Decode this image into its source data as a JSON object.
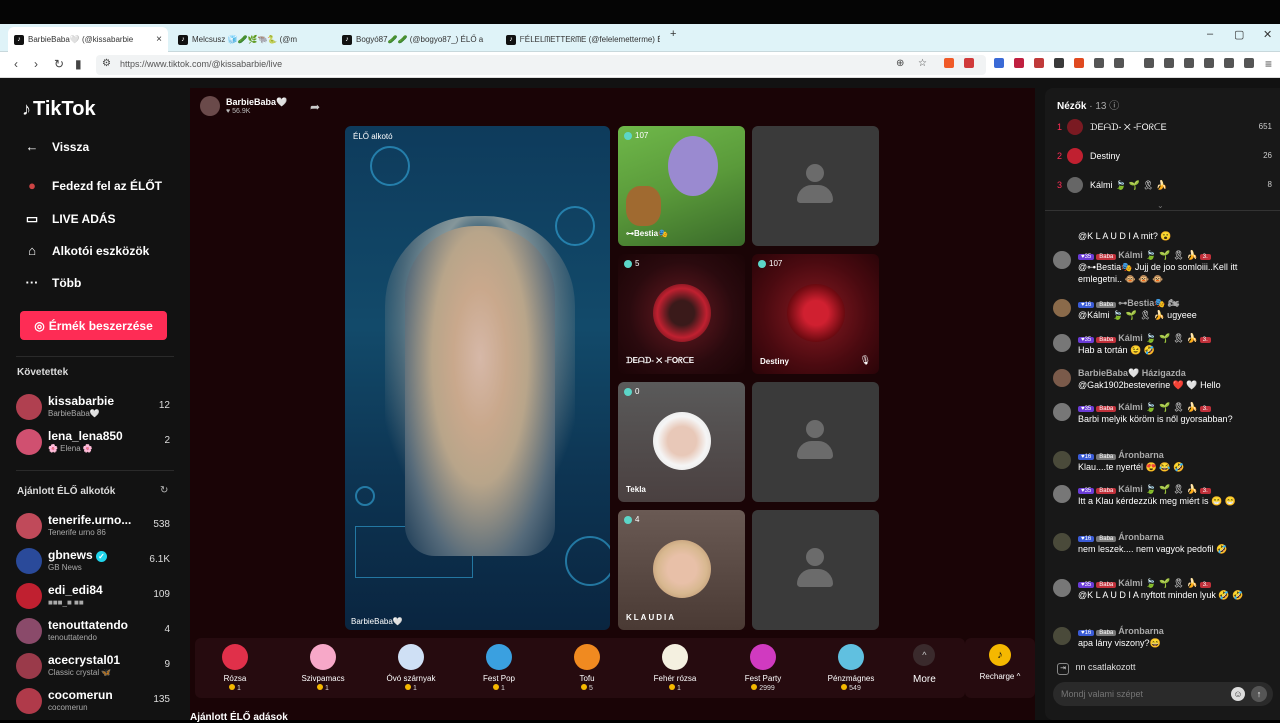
{
  "browser": {
    "tabs": [
      {
        "title": "BarbieBaba🤍 (@kissabarbie",
        "active": true
      },
      {
        "title": "Melcsusz 🧊🥒🌿🐃🐍 (@m"
      },
      {
        "title": "Bogyó87🥒🥒 (@bogyo87_) ÉLŐ a"
      },
      {
        "title": "ᖴÉᒪEᒪᗰETTEᖇᗰE (@felelemetterme) É"
      }
    ],
    "close_tab": "×",
    "new_tab": "+",
    "window_controls": [
      "–",
      "▢",
      "✕"
    ],
    "url": "https://www.tiktok.com/@kissabarbie/live"
  },
  "sidebar": {
    "logo": "TikTok",
    "nav": [
      {
        "label": "Vissza",
        "icon": "←"
      },
      {
        "label": "Fedezd fel az ÉLŐT",
        "icon": "●"
      },
      {
        "label": "LIVE ADÁS",
        "icon": "▭"
      },
      {
        "label": "Alkotói eszközök",
        "icon": "⌂"
      },
      {
        "label": "Több",
        "icon": "···"
      }
    ],
    "coin_button": "Érmék beszerzése",
    "following_title": "Követettek",
    "following": [
      {
        "name": "kissabarbie",
        "sub": "BarbieBaba🤍",
        "count": "12"
      },
      {
        "name": "lena_lena850",
        "sub": "🌸 Elena 🌸",
        "count": "2"
      }
    ],
    "recommended_title": "Ajánlott ÉLŐ alkotók",
    "recommended": [
      {
        "name": "tenerife.urno...",
        "sub": "Tenerife urno 86",
        "count": "538"
      },
      {
        "name": "gbnews",
        "sub": "GB News",
        "count": "6.1K"
      },
      {
        "name": "edi_edi84",
        "sub": "■■■_■ ■■",
        "count": "109"
      },
      {
        "name": "tenouttatendo",
        "sub": "tenouttatendo",
        "count": "4"
      },
      {
        "name": "acecrystal01",
        "sub": "Classic crystal 🦋",
        "count": "9"
      },
      {
        "name": "cocomerun",
        "sub": "cocomerun",
        "count": "135"
      }
    ]
  },
  "live": {
    "host_name": "BarbieBaba🤍",
    "host_likes": "♥ 56.9K",
    "stream_label": "ÉLŐ alkotó",
    "stream_name": "BarbieBaba🤍",
    "guests": [
      {
        "count": "107",
        "name": "⊶Bestia🎭"
      },
      {
        "count": "",
        "name": ""
      },
      {
        "count": "5",
        "name": "ᗪEᗩᗪ- ✕ -ᖴOᖇᑕE"
      },
      {
        "count": "107",
        "name": "Destiny"
      },
      {
        "count": "0",
        "name": "Tekla"
      },
      {
        "count": "",
        "name": ""
      },
      {
        "count": "4",
        "name": "KLAUDIA"
      },
      {
        "count": "",
        "name": ""
      }
    ]
  },
  "gifts": [
    {
      "label": "Rózsa",
      "price": "1",
      "color": "#e0304a"
    },
    {
      "label": "Szivpamacs",
      "price": "1",
      "color": "#f7a8c8"
    },
    {
      "label": "Óvó szárnyak",
      "price": "1",
      "color": "#cfe0f5"
    },
    {
      "label": "Fest Pop",
      "price": "1",
      "color": "#3aa0e0"
    },
    {
      "label": "Tofu",
      "price": "5",
      "color": "#f08a20"
    },
    {
      "label": "Fehér rózsa",
      "price": "1",
      "color": "#f4f0e0"
    },
    {
      "label": "Fest Party",
      "price": "2999",
      "color": "#d03ac0"
    },
    {
      "label": "Pénzmágnes",
      "price": "549",
      "color": "#60c0e0"
    }
  ],
  "more_label": "More",
  "recharge_label": "Recharge ^",
  "bottom_heading": "Ajánlott ÉLŐ adások",
  "chat": {
    "viewers_title": "Nézők",
    "viewers_count": "· 13",
    "top_viewers": [
      {
        "rank": "1",
        "name": "ᗪEᗩᗪ- ✕ -ᖴOᖇᑕE",
        "score": "651"
      },
      {
        "rank": "2",
        "name": "Destiny",
        "score": "26"
      },
      {
        "rank": "3",
        "name": "Kálmi 🍃 🌱 🎗 🍌",
        "score": "8"
      }
    ],
    "messages": [
      {
        "header": "",
        "text": "@K L A U D I A mit? 😮"
      },
      {
        "header": "Kálmi 🍃 🌱 🎗 🍌",
        "text": "@⊶Bestia🎭 Jujj de joo somloiii..Kell itt emlegetni.. 🐵 🐵 🐵"
      },
      {
        "header": "⊶Bestia🎭 🏍",
        "text": "@Kálmi 🍃 🌱 🎗 🍌 ugyeee"
      },
      {
        "header": "Kálmi 🍃 🌱 🎗 🍌",
        "text": "Hab a tortán 😉 🤣"
      },
      {
        "header": "BarbieBaba🤍  Házigazda",
        "text": "@Gak1902besteverine ❤️ 🤍 Hello"
      },
      {
        "header": "Kálmi 🍃 🌱 🎗 🍌",
        "text": "Barbi melyik köröm is nől gyorsabban?"
      },
      {
        "header": "Áronbarna",
        "text": "Klau....te nyertél 😍 😂 🤣"
      },
      {
        "header": "Kálmi 🍃 🌱 🎗 🍌",
        "text": "Itt a Klau kérdezzük meg miért is 😁 😁"
      },
      {
        "header": "Áronbarna",
        "text": "nem leszek.... nem vagyok pedofil 🤣"
      },
      {
        "header": "Kálmi 🍃 🌱 🎗 🍌",
        "text": "@K L A U D I A nyftott minden lyuk 🤣 🤣"
      },
      {
        "header": "Áronbarna",
        "text": "apa lány viszony?😄"
      }
    ],
    "joined_text": "nn  csatlakozott",
    "input_placeholder": "Mondj valami szépet"
  }
}
